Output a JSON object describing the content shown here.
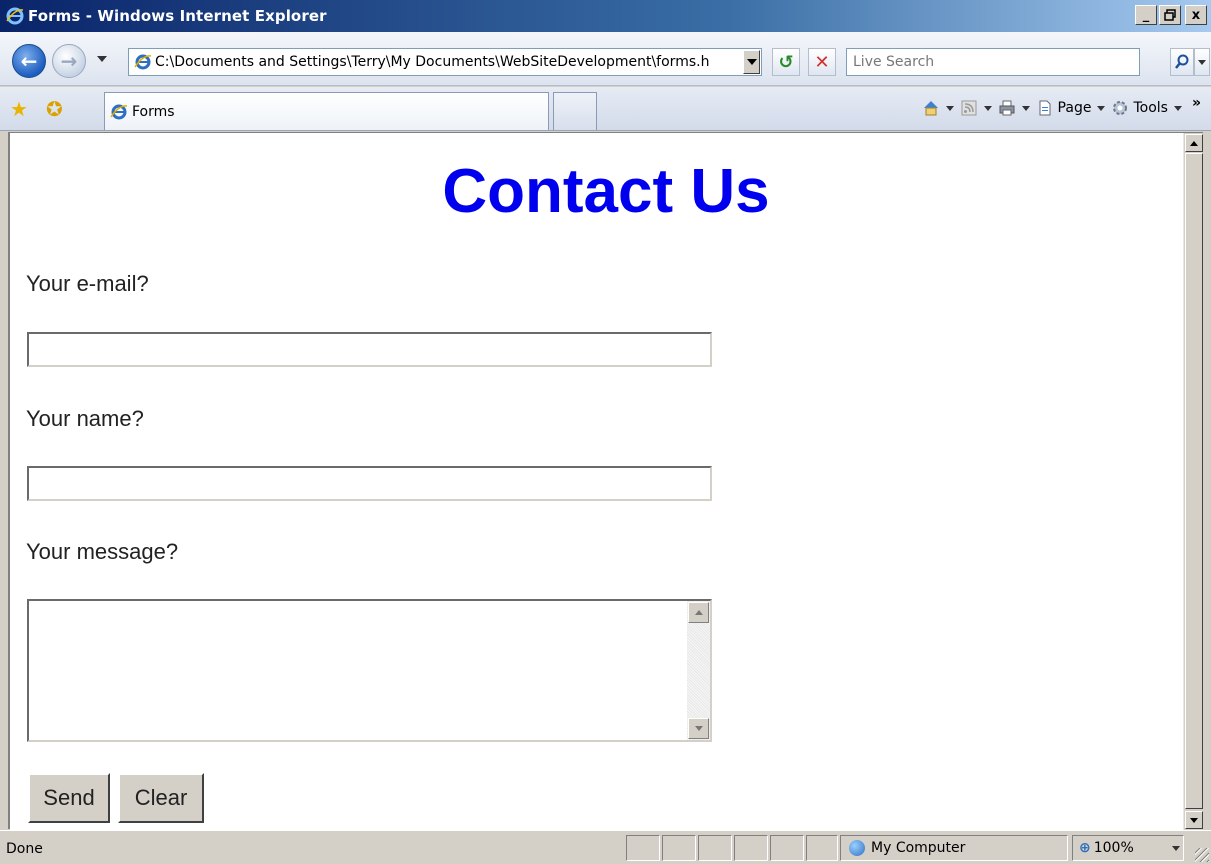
{
  "window": {
    "title": "Forms - Windows Internet Explorer",
    "minimize_label": "_",
    "maximize_label": "3",
    "close_label": "x"
  },
  "nav": {
    "address": "C:\\Documents and Settings\\Terry\\My Documents\\WebSiteDevelopment\\forms.h",
    "search_placeholder": "Live Search"
  },
  "tabs": [
    {
      "label": "Forms",
      "active": true
    }
  ],
  "commandbar": {
    "page_label": "Page",
    "tools_label": "Tools",
    "more_label": "»"
  },
  "page": {
    "heading": "Contact Us",
    "email_label": "Your e-mail?",
    "name_label": "Your name?",
    "message_label": "Your message?",
    "send_button": "Send",
    "clear_button": "Clear",
    "email_value": "",
    "name_value": "",
    "message_value": ""
  },
  "status": {
    "text": "Done",
    "zone": "My Computer",
    "zoom": "100%"
  },
  "colors": {
    "heading": "#0000ee",
    "titlebar_start": "#0a246a",
    "titlebar_end": "#a6caf0"
  },
  "icons": {
    "browser": "ie-logo-icon",
    "back": "back-arrow-icon",
    "forward": "forward-arrow-icon",
    "refresh": "refresh-icon",
    "stop": "stop-icon",
    "search": "search-icon",
    "favorites": "favorites-star-icon",
    "add_favorites": "add-favorites-icon",
    "home": "home-icon",
    "feeds": "feeds-icon",
    "print": "print-icon",
    "page": "page-icon",
    "tools": "tools-gear-icon"
  }
}
